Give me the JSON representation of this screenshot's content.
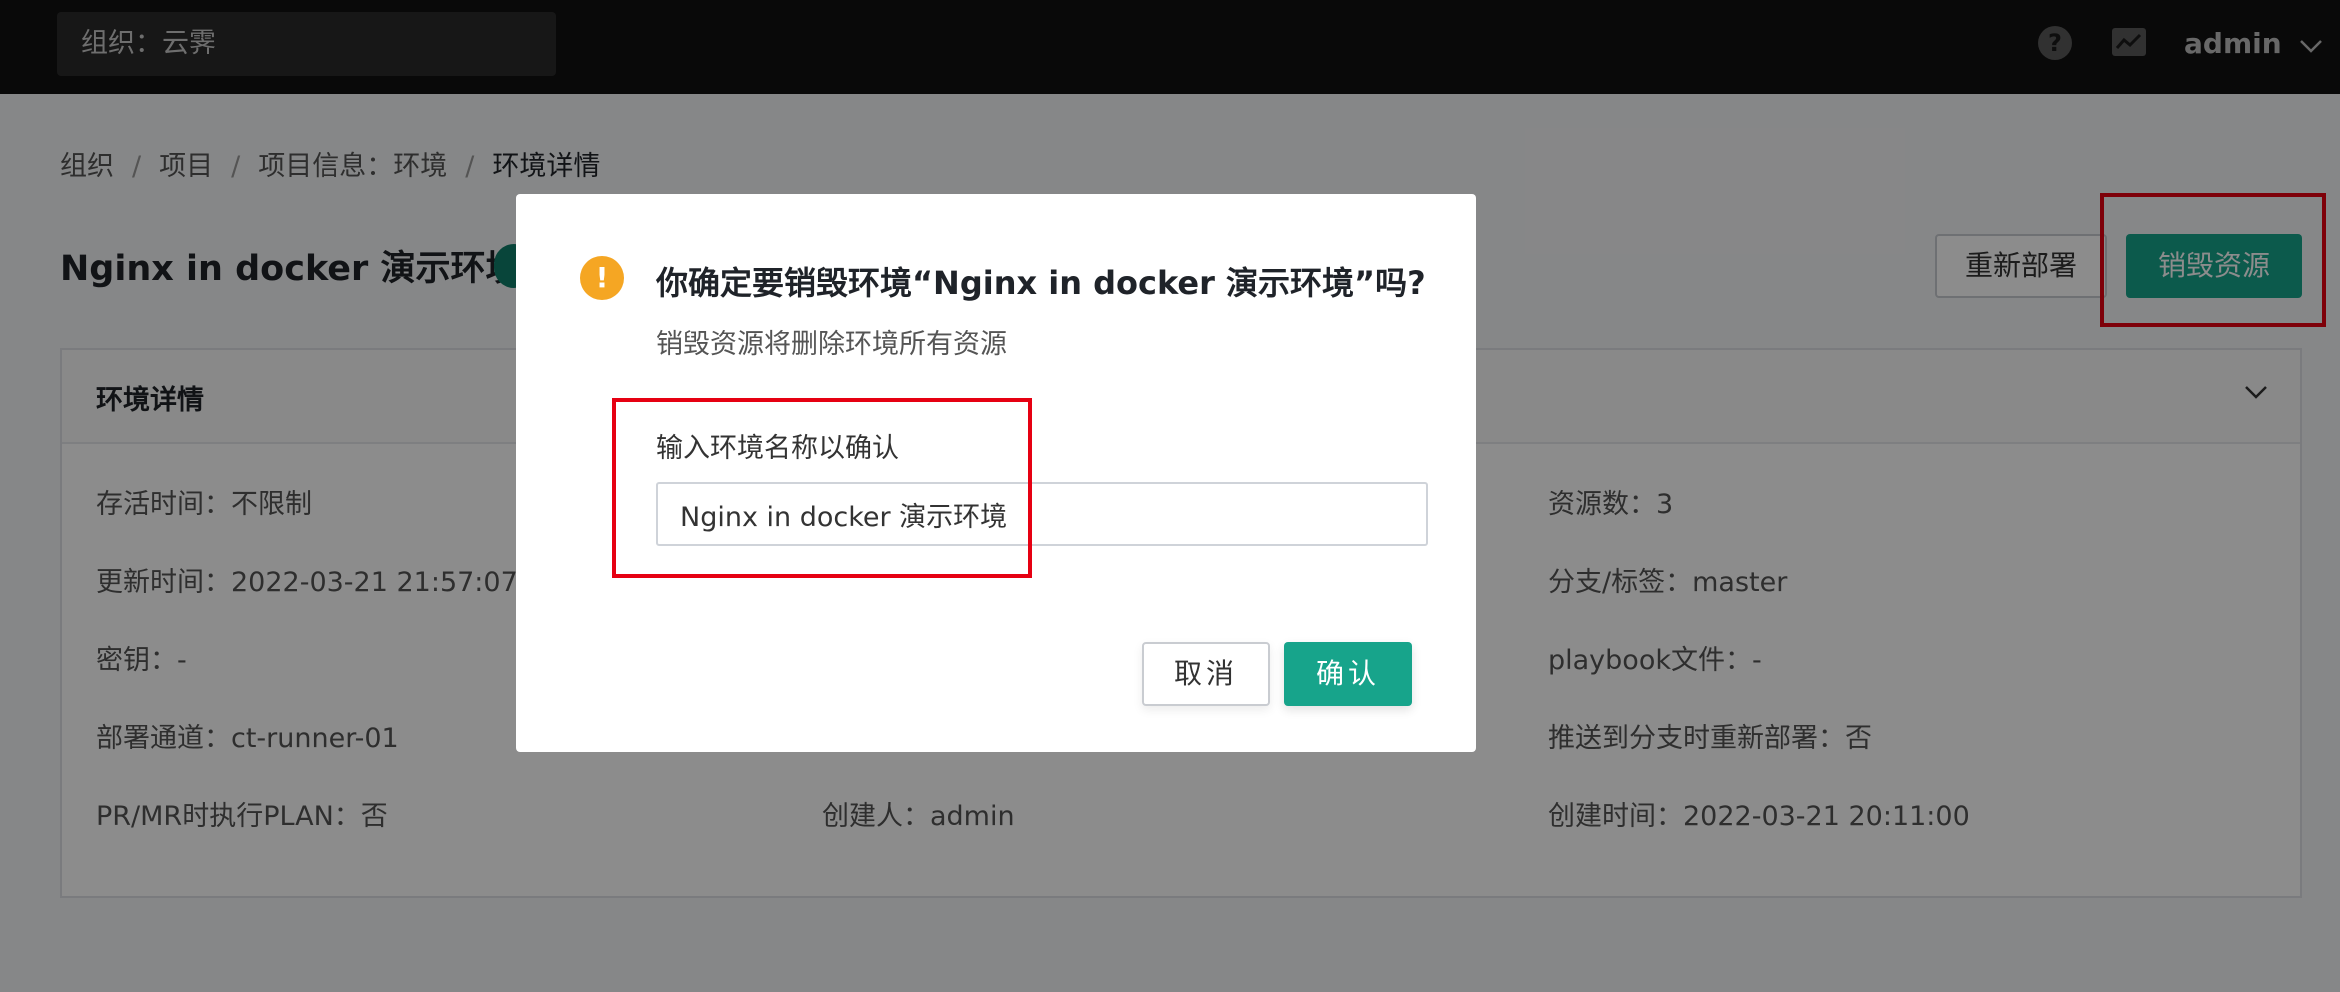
{
  "topbar": {
    "org_select": "组织：云霁",
    "help_icon": "?",
    "user_name": "admin"
  },
  "breadcrumb": [
    "组织",
    "项目",
    "项目信息：环境",
    "环境详情"
  ],
  "page": {
    "title": "Nginx in docker 演示环境",
    "redeploy_label": "重新部署",
    "destroy_label": "销毁资源"
  },
  "panel": {
    "title": "环境详情",
    "items": {
      "ttl": "存活时间：不限制",
      "updated": "更新时间：2022-03-21 21:57:07",
      "secret": "密钥：-",
      "runner": "部署通道：ct-runner-01",
      "pr_plan": "PR/MR时执行PLAN：否",
      "creator": "创建人：admin",
      "resources": "资源数：3",
      "branch": "分支/标签：master",
      "playbook": "playbook文件：-",
      "redeploy_push": "推送到分支时重新部署：否",
      "created": "创建时间：2022-03-21 20:11:00"
    }
  },
  "modal": {
    "warn_icon": "!",
    "title": "你确定要销毁环境“Nginx in docker 演示环境”吗?",
    "description": "销毁资源将删除环境所有资源",
    "input_label": "输入环境名称以确认",
    "input_value": "Nginx in docker 演示环境",
    "cancel_label": "取消",
    "ok_label": "确认"
  },
  "colors": {
    "topbar": "#111111",
    "primary": "#17a48b",
    "warning": "#f5a623",
    "highlight": "#e60012"
  }
}
